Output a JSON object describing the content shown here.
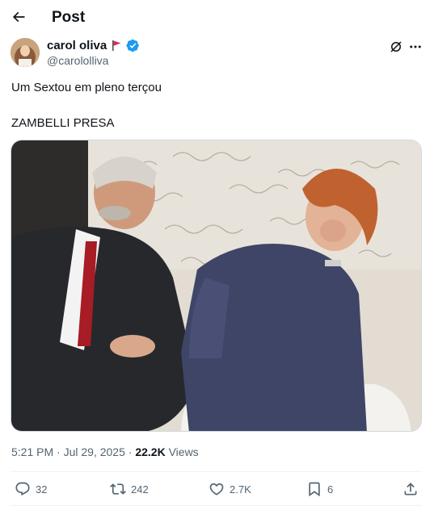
{
  "header": {
    "title": "Post",
    "back_icon": "arrow-left-icon"
  },
  "author": {
    "name": "carol oliva",
    "handle": "@carololliva",
    "flag_icon": "red-flag-icon",
    "verified_icon": "verified-badge-icon",
    "verified_color": "#1d9bf0"
  },
  "tweet": {
    "line1": "Um Sextou em pleno terçou",
    "line2": "ZAMBELLI PRESA"
  },
  "meta": {
    "time": "5:21 PM",
    "sep1": " · ",
    "date": "Jul 29, 2025",
    "sep2": " · ",
    "views_count": "22.2K",
    "views_label": " Views"
  },
  "actions": {
    "replies": "32",
    "reposts": "242",
    "likes": "2.7K",
    "bookmarks": "6"
  },
  "colors": {
    "text_primary": "#0f1419",
    "text_secondary": "#536471",
    "accent": "#1d9bf0",
    "border": "#eff3f4"
  }
}
